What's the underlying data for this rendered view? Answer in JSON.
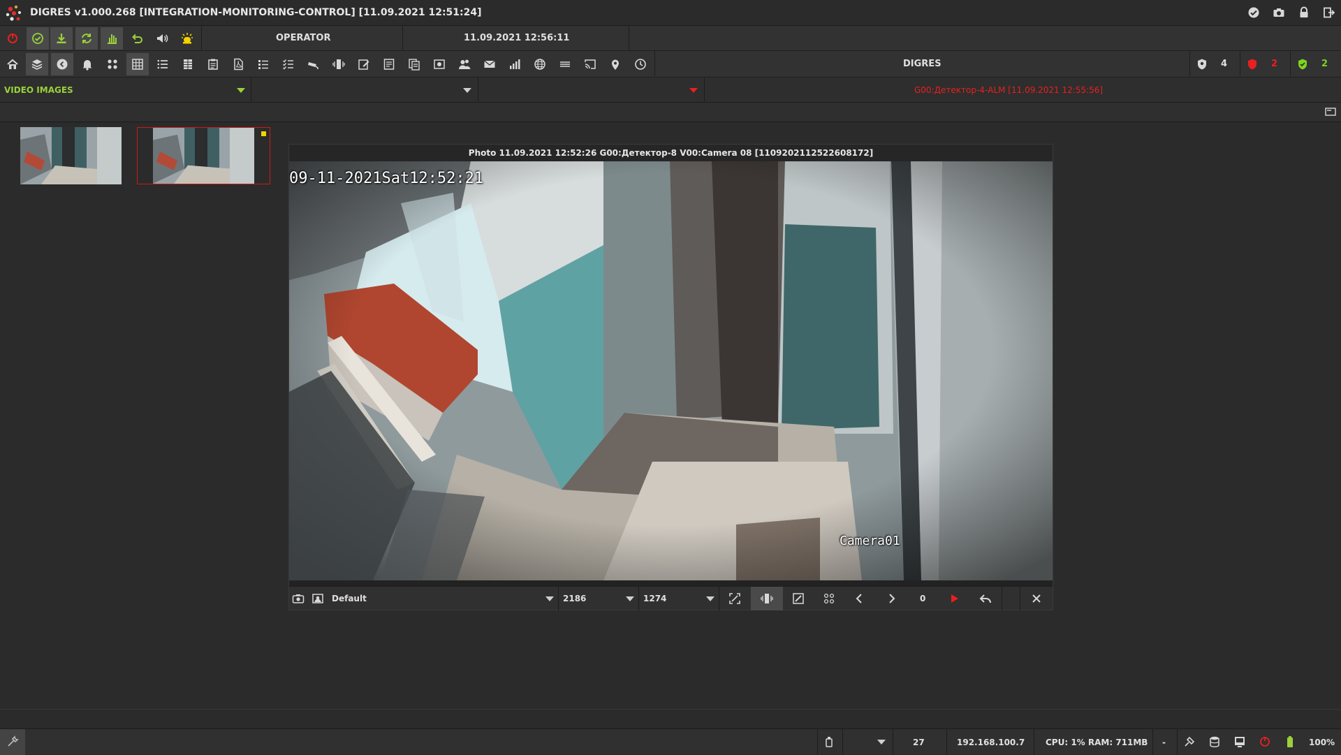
{
  "app": {
    "title": "DIGRES v1.000.268 [INTEGRATION-MONITORING-CONTROL] [11.09.2021 12:51:24]"
  },
  "toolbar1": {
    "role_label": "OPERATOR",
    "clock": "11.09.2021 12:56:11"
  },
  "toolbar2": {
    "center_label": "DIGRES",
    "counters": [
      {
        "icon": "shield-icon",
        "value": "4",
        "color": "#e0e0e0"
      },
      {
        "icon": "shield-alarm-icon",
        "value": "2",
        "color": "#e8201f"
      },
      {
        "icon": "shield-ok-icon",
        "value": "2",
        "color": "#7ed321"
      }
    ]
  },
  "filter": {
    "section": "VIDEO IMAGES",
    "second_select": "",
    "third_select": "",
    "alarm_text": "G00:Детектор-4-ALM [11.09.2021 12:55:56]"
  },
  "viewer": {
    "title": "Photo 11.09.2021 12:52:26 G00:Детектор-8 V00:Camera 08 [1109202112522608172]",
    "osd_datetime": "09-11-2021Sat12:52:21",
    "osd_camera": "Camera01",
    "profile": "Default",
    "width": "2186",
    "height": "1274",
    "counter": "0"
  },
  "status": {
    "count": "27",
    "ip": "192.168.100.7",
    "cpu_ram": "CPU: 1% RAM: 711MB",
    "dash": "-",
    "zoom": "100%"
  },
  "colors": {
    "accent_green": "#9ad13a",
    "alarm_red": "#e8201f",
    "selection_red": "#d01818",
    "bell_yellow": "#f5d200"
  }
}
